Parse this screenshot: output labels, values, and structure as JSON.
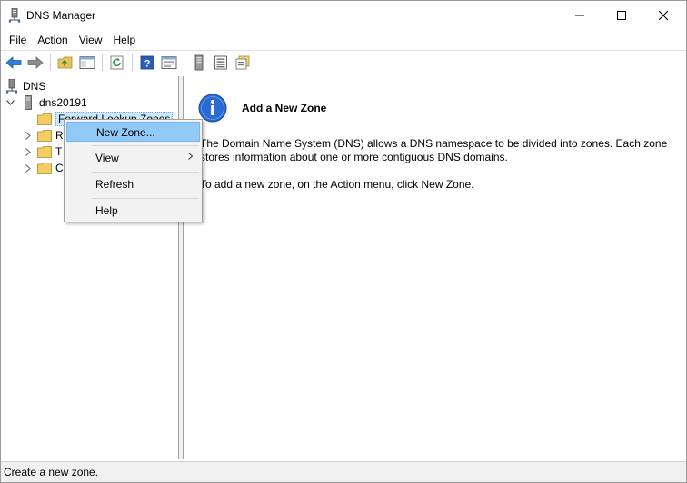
{
  "window": {
    "title": "DNS Manager"
  },
  "menubar": {
    "items": [
      "File",
      "Action",
      "View",
      "Help"
    ]
  },
  "toolbar": {
    "buttons": [
      "back-icon",
      "forward-icon",
      "up-folder-icon",
      "show-hide-console-tree-icon",
      "refresh-icon",
      "help-icon",
      "properties-icon",
      "server-icon",
      "list-icon",
      "zones-icon"
    ]
  },
  "tree": {
    "root": "DNS",
    "server": "dns20191",
    "forward_zones": "Forward Lookup Zones",
    "reverse_zones_partial": "R",
    "trust_points_partial": "T",
    "conditional_forwarders_partial": "C"
  },
  "right_pane": {
    "heading": "Add a New Zone",
    "para1_line1": "The Domain Name System (DNS) allows a DNS namespace to be divided into zones. Each zone",
    "para1_line2": "stores information about one or more contiguous DNS domains.",
    "para2": "To add a new zone, on the Action menu, click New Zone."
  },
  "context_menu": {
    "items": [
      {
        "label": "New Zone...",
        "highlighted": true
      },
      {
        "label": "View",
        "submenu": true
      },
      {
        "label": "Refresh"
      },
      {
        "label": "Help"
      }
    ]
  },
  "statusbar": {
    "text": "Create a new zone."
  },
  "colors": {
    "selection": "#cce8ff",
    "menu_highlight": "#91c9f7",
    "info_blue": "#2a6bd1"
  }
}
